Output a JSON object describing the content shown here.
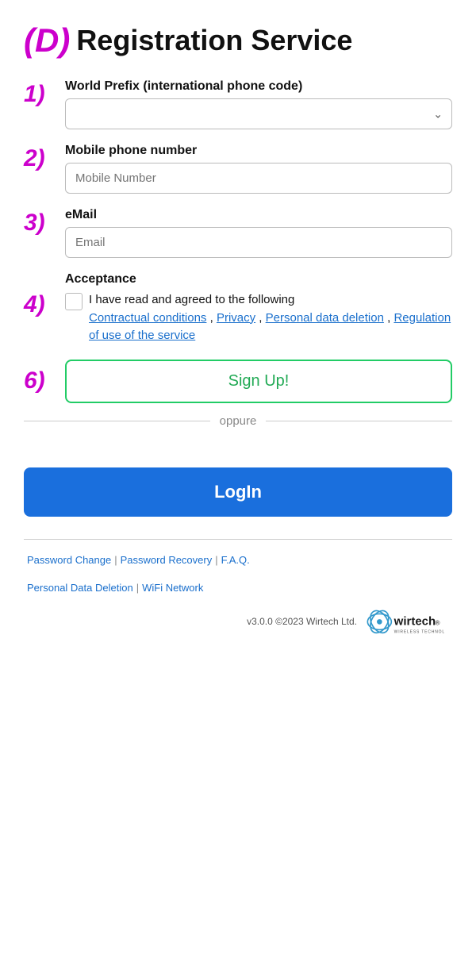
{
  "header": {
    "d_label": "(D)",
    "title": "Registration Service"
  },
  "steps": {
    "s1": "1)",
    "s2": "2)",
    "s3": "3)",
    "s4": "4)",
    "s6": "6)"
  },
  "fields": {
    "world_prefix_label": "World Prefix (international phone code)",
    "world_prefix_placeholder": "",
    "mobile_label": "Mobile phone number",
    "mobile_placeholder": "Mobile Number",
    "email_label": "eMail",
    "email_placeholder": "Email"
  },
  "acceptance": {
    "section_label": "Acceptance",
    "text_before": "I have read and agreed to the following",
    "link1": "Contractual conditions",
    "link2": "Privacy",
    "link3": "Personal data deletion",
    "link4": "Regulation of use of the service"
  },
  "buttons": {
    "signup": "Sign Up!",
    "login": "LogIn"
  },
  "divider": {
    "text": "oppure"
  },
  "footer": {
    "link1": "Password Change",
    "link2": "Password Recovery",
    "link3": "F.A.Q.",
    "link4": "Personal Data Deletion",
    "link5": "WiFi Network",
    "version": "v3.0.0 ©2023 Wirtech Ltd."
  }
}
